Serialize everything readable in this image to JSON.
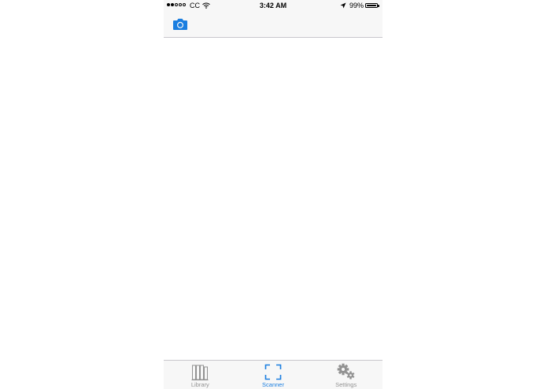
{
  "status_bar": {
    "carrier": "CC",
    "time": "3:42 AM",
    "battery_percent": "99%",
    "battery_level": 0.99,
    "signal_bars_filled": 2,
    "signal_bars_total": 5
  },
  "nav_bar": {
    "left_icon": "camera-icon"
  },
  "tab_bar": {
    "tabs": [
      {
        "label": "Library",
        "icon": "library-icon",
        "active": false
      },
      {
        "label": "Scanner",
        "icon": "scanner-icon",
        "active": true
      },
      {
        "label": "Settings",
        "icon": "settings-icon",
        "active": false
      }
    ]
  },
  "colors": {
    "accent": "#1a7ee0",
    "inactive": "#929292",
    "bar_background": "#f7f7f7",
    "separator": "#c8c7cc"
  }
}
